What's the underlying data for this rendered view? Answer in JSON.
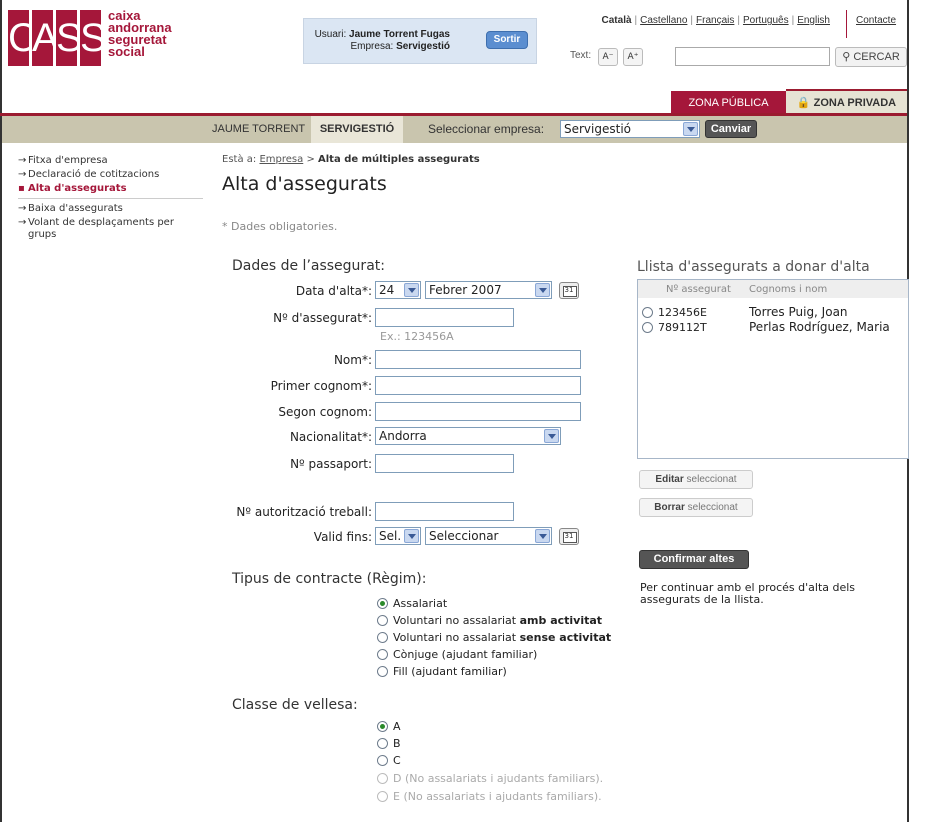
{
  "header": {
    "logo": {
      "letters": [
        "C",
        "A",
        "S",
        "S"
      ],
      "lines": [
        "caixa",
        "andorrana",
        "seguretat",
        "social"
      ]
    },
    "user_label": "Usuari:",
    "user_name": "Jaume Torrent Fugas",
    "company_label": "Empresa:",
    "company_name": "Servigestió",
    "logout": "Sortir",
    "languages": [
      "Català",
      "Castellano",
      "Français",
      "Português",
      "English"
    ],
    "contact": "Contacte",
    "text_label": "Text:",
    "text_smaller": "A⁻",
    "text_larger": "A⁺",
    "search_value": "",
    "search_button": "CERCAR",
    "zone_public": "ZONA PÚBLICA",
    "zone_private": "ZONA PRIVADA"
  },
  "subnav": {
    "user": "JAUME TORRENT",
    "company": "SERVIGESTIÓ",
    "select_label": "Seleccionar empresa:",
    "select_value": "Servigestió",
    "change": "Canviar"
  },
  "sidebar": {
    "items": [
      "Fitxa d'empresa",
      "Declaració de cotitzacions",
      "Alta d'assegurats",
      "Baixa d'assegurats",
      "Volant de desplaçaments per grups"
    ],
    "active": 2
  },
  "breadcrumb": {
    "prefix": "Està a:",
    "parent": "Empresa",
    "sep": ">",
    "current": "Alta de múltiples assegurats"
  },
  "page_title": "Alta d'assegurats",
  "required_note": "* Dades obligatories.",
  "form": {
    "section_title": "Dades de l’assegurat:",
    "date_label": "Data d'alta*:",
    "date_day": "24",
    "date_month": "Febrer 2007",
    "insured_no_label": "Nº d'assegurat*:",
    "insured_no_value": "",
    "insured_no_hint": "Ex.: 123456A",
    "name_label": "Nom*:",
    "surname1_label": "Primer cognom*:",
    "surname2_label": "Segon cognom:",
    "nationality_label": "Nacionalitat*:",
    "nationality_value": "Andorra",
    "passport_label": "Nº passaport:",
    "work_permit_label": "Nº autorització treball:",
    "valid_until_label": "Valid fins:",
    "valid_day": "Sel.",
    "valid_month": "Seleccionar",
    "calendar_icon": "31"
  },
  "contract": {
    "title": "Tipus de contracte (Règim):",
    "options": [
      {
        "text": "Assalariat",
        "bold": "",
        "checked": true
      },
      {
        "text": "Voluntari no assalariat ",
        "bold": "amb activitat",
        "checked": false
      },
      {
        "text": "Voluntari no assalariat ",
        "bold": "sense activitat",
        "checked": false
      },
      {
        "text": "Cònjuge (ajudant familiar)",
        "bold": "",
        "checked": false
      },
      {
        "text": "Fill (ajudant familiar)",
        "bold": "",
        "checked": false
      }
    ]
  },
  "class": {
    "title": "Classe de vellesa:",
    "options": [
      {
        "text": "A",
        "checked": true,
        "disabled": false
      },
      {
        "text": "B",
        "checked": false,
        "disabled": false
      },
      {
        "text": "C",
        "checked": false,
        "disabled": false
      },
      {
        "text": "D (No assalariats i ajudants familiars).",
        "checked": false,
        "disabled": true
      },
      {
        "text": "E (No assalariats i ajudants familiars).",
        "checked": false,
        "disabled": true
      }
    ]
  },
  "list": {
    "title": "Llista d'assegurats a donar d'alta",
    "col1": "Nº assegurat",
    "col2": "Cognoms i nom",
    "rows": [
      {
        "no": "123456E",
        "name": "Torres Puig, Joan"
      },
      {
        "no": "789112T",
        "name": "Perlas Rodríguez, Maria"
      }
    ],
    "edit_bold": "Editar",
    "edit_rest": " seleccionat",
    "delete_bold": "Borrar",
    "delete_rest": " seleccionat",
    "confirm": "Confirmar altes",
    "note": "Per continuar amb el procés d'alta dels assegurats de la llista."
  }
}
